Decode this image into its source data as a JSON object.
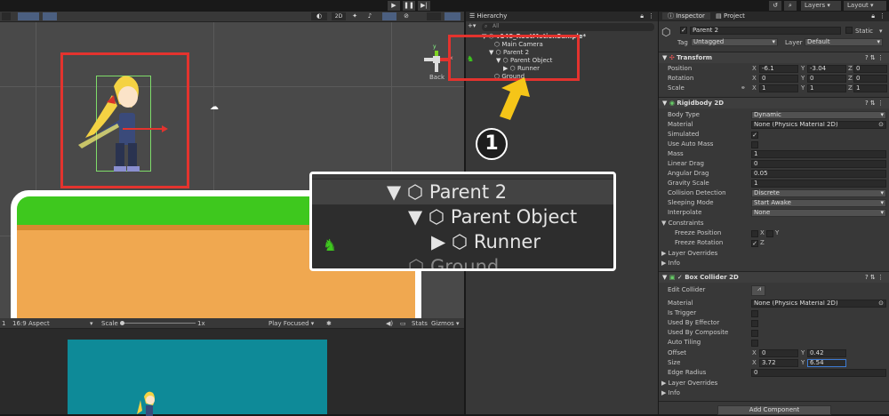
{
  "toolbar": {
    "play_icon": "play-icon",
    "pause_icon": "pause-icon",
    "step_icon": "step-icon",
    "layers": "Layers",
    "layout": "Layout"
  },
  "scene": {
    "mode_2d": "2D",
    "back_label": "Back",
    "axis_y": "y",
    "axis_x": "x"
  },
  "game": {
    "display": "1",
    "aspect": "16:9 Aspect",
    "scale_label": "Scale",
    "scale_value": "1x",
    "play_mode": "Play Focused",
    "stats": "Stats",
    "gizmos": "Gizmos"
  },
  "hierarchy": {
    "tab": "Hierarchy",
    "search_placeholder": "All",
    "scene_name": "v148_RootMotionSample*",
    "items": [
      {
        "label": "Main Camera",
        "depth": 1,
        "arrow": ""
      },
      {
        "label": "Parent 2",
        "depth": 1,
        "arrow": "▼"
      },
      {
        "label": "Parent Object",
        "depth": 2,
        "arrow": "▼"
      },
      {
        "label": "Runner",
        "depth": 3,
        "arrow": "▶"
      },
      {
        "label": "Ground",
        "depth": 1,
        "arrow": ""
      }
    ]
  },
  "annotation": {
    "step_number": "1",
    "zoom_items": [
      "Parent 2",
      "Parent Object",
      "Runner",
      "Ground"
    ]
  },
  "inspector": {
    "tab_inspector": "Inspector",
    "tab_project": "Project",
    "object_name": "Parent 2",
    "static_label": "Static",
    "tag_label": "Tag",
    "tag_value": "Untagged",
    "layer_label": "Layer",
    "layer_value": "Default",
    "transform": {
      "title": "Transform",
      "position_label": "Position",
      "position": [
        "-6.1",
        "-3.04",
        "0"
      ],
      "rotation_label": "Rotation",
      "rotation": [
        "0",
        "0",
        "0"
      ],
      "scale_label": "Scale",
      "scale": [
        "1",
        "1",
        "1"
      ],
      "axes": [
        "X",
        "Y",
        "Z"
      ]
    },
    "rigidbody": {
      "title": "Rigidbody 2D",
      "body_type_label": "Body Type",
      "body_type": "Dynamic",
      "material_label": "Material",
      "material": "None (Physics Material 2D)",
      "simulated_label": "Simulated",
      "auto_mass_label": "Use Auto Mass",
      "mass_label": "Mass",
      "mass": "1",
      "linear_drag_label": "Linear Drag",
      "linear_drag": "0",
      "angular_drag_label": "Angular Drag",
      "angular_drag": "0.05",
      "gravity_label": "Gravity Scale",
      "gravity": "1",
      "collision_label": "Collision Detection",
      "collision": "Discrete",
      "sleeping_label": "Sleeping Mode",
      "sleeping": "Start Awake",
      "interpolate_label": "Interpolate",
      "interpolate": "None",
      "constraints_label": "Constraints",
      "freeze_pos_label": "Freeze Position",
      "freeze_rot_label": "Freeze Rotation",
      "layer_overrides": "Layer Overrides",
      "info": "Info"
    },
    "boxcollider": {
      "title": "Box Collider 2D",
      "edit_label": "Edit Collider",
      "material_label": "Material",
      "material": "None (Physics Material 2D)",
      "trigger_label": "Is Trigger",
      "effector_label": "Used By Effector",
      "composite_label": "Used By Composite",
      "tiling_label": "Auto Tiling",
      "offset_label": "Offset",
      "offset": [
        "0",
        "0.42"
      ],
      "size_label": "Size",
      "size": [
        "3.72",
        "6.54"
      ],
      "edge_label": "Edge Radius",
      "edge": "0",
      "layer_overrides": "Layer Overrides",
      "info": "Info"
    },
    "add_component": "Add Component"
  },
  "colors": {
    "annotation_red": "#e3332e",
    "arrow_yellow": "#f5c518",
    "grass": "#3ec81e",
    "dirt": "#f0a850",
    "game_bg": "#0e8a98"
  }
}
